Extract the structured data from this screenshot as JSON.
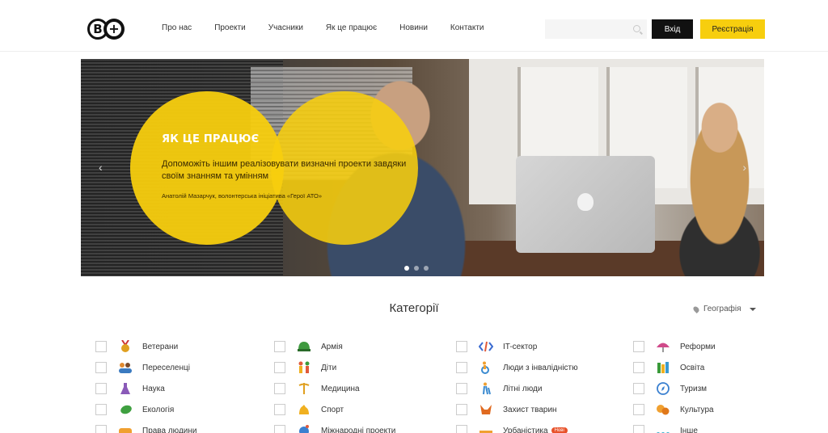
{
  "header": {
    "logo_text": "B",
    "nav": [
      "Про нас",
      "Проекти",
      "Учасники",
      "Як це працює",
      "Новини",
      "Контакти"
    ],
    "search_placeholder": "",
    "login_label": "Вхід",
    "register_label": "Реєстрація"
  },
  "hero": {
    "title": "ЯК ЦЕ ПРАЦЮЄ",
    "subtitle": "Допоможіть іншим реалізовувати визначні проекти завдяки своїм знанням та умінням",
    "author": "Анатолій Мазарчук, волонтерська ініціатива «Герої АТО»",
    "slides": 3,
    "active_slide": 1
  },
  "categories": {
    "title": "Категорії",
    "geo_label": "Географія",
    "columns": [
      [
        {
          "label": "Ветерани",
          "icon": "medal-icon",
          "color": "#e0a020"
        },
        {
          "label": "Переселенці",
          "icon": "people-icon",
          "color": "#e08a30"
        },
        {
          "label": "Наука",
          "icon": "flask-icon",
          "color": "#8a5ab8"
        },
        {
          "label": "Екологія",
          "icon": "leaf-icon",
          "color": "#3fa040"
        },
        {
          "label": "Права людини",
          "icon": "hands-icon",
          "color": "#f0a030"
        }
      ],
      [
        {
          "label": "Армія",
          "icon": "helmet-icon",
          "color": "#3f9a3f"
        },
        {
          "label": "Діти",
          "icon": "children-icon",
          "color": "#e05a3a"
        },
        {
          "label": "Медицина",
          "icon": "caduceus-icon",
          "color": "#e0a020"
        },
        {
          "label": "Спорт",
          "icon": "muscle-icon",
          "color": "#f0b020"
        },
        {
          "label": "Міжнародні проекти",
          "icon": "globe-icon",
          "color": "#3a80d0"
        }
      ],
      [
        {
          "label": "IT-сектор",
          "icon": "code-icon",
          "color": "#3a6ad0"
        },
        {
          "label": "Люди з інвалідністю",
          "icon": "wheelchair-icon",
          "color": "#3a8ad0"
        },
        {
          "label": "Літні люди",
          "icon": "elder-icon",
          "color": "#3a8ad0"
        },
        {
          "label": "Захист тварин",
          "icon": "fox-icon",
          "color": "#e06a20"
        },
        {
          "label": "Урбаністика",
          "icon": "city-icon",
          "color": "#f0a030",
          "badge": "Нові"
        }
      ],
      [
        {
          "label": "Реформи",
          "icon": "umbrella-icon",
          "color": "#d04a8a"
        },
        {
          "label": "Освіта",
          "icon": "books-icon",
          "color": "#3a9ad0"
        },
        {
          "label": "Туризм",
          "icon": "compass-icon",
          "color": "#3a80d0"
        },
        {
          "label": "Культура",
          "icon": "masks-icon",
          "color": "#f0a030"
        },
        {
          "label": "Інше",
          "icon": "dots-icon",
          "color": "#3ab0d0"
        }
      ]
    ]
  },
  "colors": {
    "accent": "#f7ce0e",
    "dark": "#111111"
  }
}
